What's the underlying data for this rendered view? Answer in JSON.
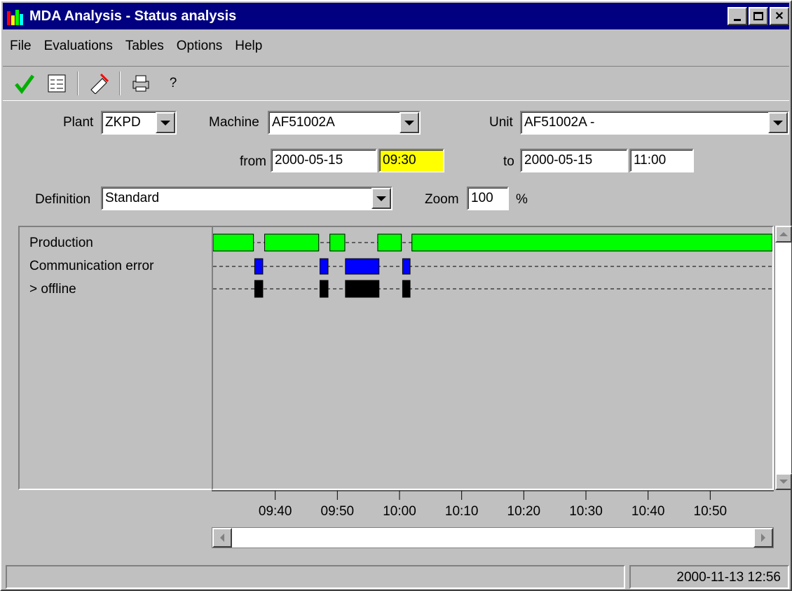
{
  "window": {
    "title": "MDA Analysis - Status analysis"
  },
  "menu": [
    {
      "label": "File"
    },
    {
      "label": "Evaluations"
    },
    {
      "label": "Tables"
    },
    {
      "label": "Options"
    },
    {
      "label": "Help"
    }
  ],
  "toolbar": {
    "icons": [
      "checkmark-icon",
      "evaluation-icon",
      "edit-delete-icon",
      "print-icon"
    ],
    "help_label": "?"
  },
  "form": {
    "plant_label": "Plant",
    "plant_value": "ZKPD",
    "machine_label": "Machine",
    "machine_value": "AF51002A",
    "unit_label": "Unit",
    "unit_value": "AF51002A -",
    "from_label": "from",
    "from_date": "2000-05-15",
    "from_time": "09:30",
    "to_label": "to",
    "to_date": "2000-05-15",
    "to_time": "11:00",
    "definition_label": "Definition",
    "definition_value": "Standard",
    "zoom_label": "Zoom",
    "zoom_value": "100",
    "zoom_unit": "%"
  },
  "colors": {
    "production": "#00ff00",
    "comm_error": "#0000ff",
    "offline": "#000000",
    "highlight_time": "#ffff00"
  },
  "chart_data": {
    "type": "gantt",
    "rows": [
      "Production",
      "Communication error",
      "> offline"
    ],
    "x_range": [
      "09:30",
      "11:00"
    ],
    "ticks": [
      "09:40",
      "09:50",
      "10:00",
      "10:10",
      "10:20",
      "10:30",
      "10:40",
      "10:50"
    ],
    "segments": [
      {
        "row": 0,
        "start": "09:30",
        "end": "09:36.5"
      },
      {
        "row": 0,
        "start": "09:38.3",
        "end": "09:47"
      },
      {
        "row": 0,
        "start": "09:48.8",
        "end": "09:51.2"
      },
      {
        "row": 0,
        "start": "09:56.5",
        "end": "10:00.3"
      },
      {
        "row": 0,
        "start": "10:02",
        "end": "11:00"
      },
      {
        "row": 1,
        "start": "09:36.7",
        "end": "09:38"
      },
      {
        "row": 1,
        "start": "09:47.2",
        "end": "09:48.5"
      },
      {
        "row": 1,
        "start": "09:51.3",
        "end": "09:56.7"
      },
      {
        "row": 1,
        "start": "10:00.5",
        "end": "10:01.7"
      },
      {
        "row": 2,
        "start": "09:36.7",
        "end": "09:38"
      },
      {
        "row": 2,
        "start": "09:47.2",
        "end": "09:48.5"
      },
      {
        "row": 2,
        "start": "09:51.3",
        "end": "09:56.7"
      },
      {
        "row": 2,
        "start": "10:00.5",
        "end": "10:01.7"
      }
    ]
  },
  "status": {
    "left": "",
    "datetime": "2000-11-13 12:56"
  }
}
